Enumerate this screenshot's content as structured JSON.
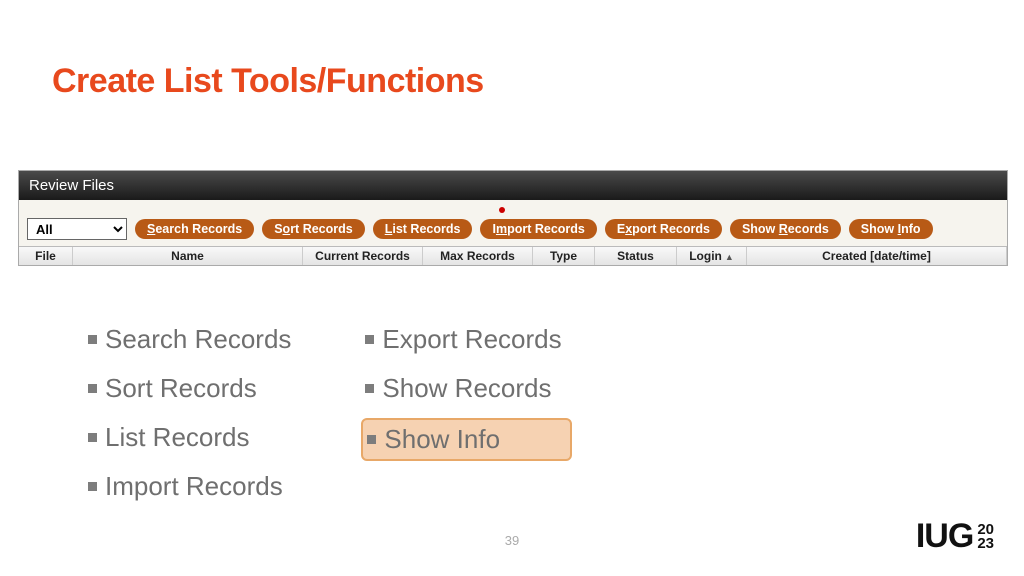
{
  "title": "Create List Tools/Functions",
  "app": {
    "window_title": "Review Files",
    "filter_value": "All",
    "buttons": [
      {
        "pre": "",
        "key": "S",
        "post": "earch Records"
      },
      {
        "pre": "S",
        "key": "o",
        "post": "rt Records"
      },
      {
        "pre": "",
        "key": "L",
        "post": "ist Records"
      },
      {
        "pre": "I",
        "key": "m",
        "post": "port Records"
      },
      {
        "pre": "E",
        "key": "x",
        "post": "port Records"
      },
      {
        "pre": "Show ",
        "key": "R",
        "post": "ecords"
      },
      {
        "pre": "Show ",
        "key": "I",
        "post": "nfo"
      }
    ],
    "columns": {
      "file": "File",
      "name": "Name",
      "current": "Current Records",
      "max": "Max Records",
      "type": "Type",
      "status": "Status",
      "login": "Login",
      "created": "Created [date/time]"
    }
  },
  "bullets": {
    "left": [
      {
        "text": "Search Records",
        "highlight": false
      },
      {
        "text": "Sort Records",
        "highlight": false
      },
      {
        "text": "List Records",
        "highlight": false
      },
      {
        "text": "Import Records",
        "highlight": false
      }
    ],
    "right": [
      {
        "text": "Export Records",
        "highlight": false
      },
      {
        "text": "Show Records",
        "highlight": false
      },
      {
        "text": "Show Info",
        "highlight": true
      }
    ]
  },
  "page_number": "39",
  "logo": {
    "text": "IUG",
    "year_top": "20",
    "year_bottom": "23"
  }
}
